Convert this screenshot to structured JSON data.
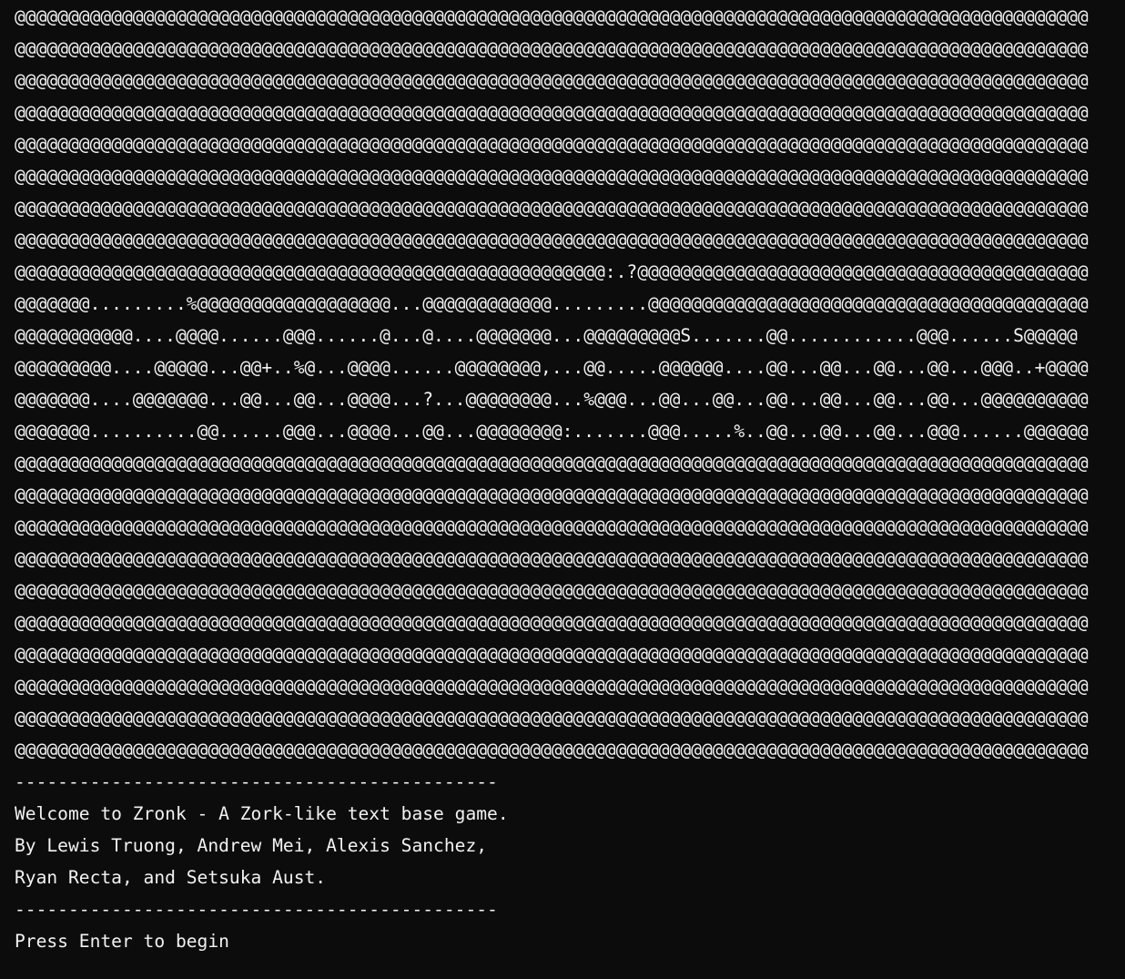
{
  "window": {
    "background": "#0c0c0c",
    "foreground": "#f2f2f2"
  },
  "art": [
    "@@@@@@@@@@@@@@@@@@@@@@@@@@@@@@@@@@@@@@@@@@@@@@@@@@@@@@@@@@@@@@@@@@@@@@@@@@@@@@@@@@@@@@@@@@@@@@@@@@@@",
    "@@@@@@@@@@@@@@@@@@@@@@@@@@@@@@@@@@@@@@@@@@@@@@@@@@@@@@@@@@@@@@@@@@@@@@@@@@@@@@@@@@@@@@@@@@@@@@@@@@@@",
    "@@@@@@@@@@@@@@@@@@@@@@@@@@@@@@@@@@@@@@@@@@@@@@@@@@@@@@@@@@@@@@@@@@@@@@@@@@@@@@@@@@@@@@@@@@@@@@@@@@@@",
    "@@@@@@@@@@@@@@@@@@@@@@@@@@@@@@@@@@@@@@@@@@@@@@@@@@@@@@@@@@@@@@@@@@@@@@@@@@@@@@@@@@@@@@@@@@@@@@@@@@@@",
    "@@@@@@@@@@@@@@@@@@@@@@@@@@@@@@@@@@@@@@@@@@@@@@@@@@@@@@@@@@@@@@@@@@@@@@@@@@@@@@@@@@@@@@@@@@@@@@@@@@@@",
    "@@@@@@@@@@@@@@@@@@@@@@@@@@@@@@@@@@@@@@@@@@@@@@@@@@@@@@@@@@@@@@@@@@@@@@@@@@@@@@@@@@@@@@@@@@@@@@@@@@@@",
    "@@@@@@@@@@@@@@@@@@@@@@@@@@@@@@@@@@@@@@@@@@@@@@@@@@@@@@@@@@@@@@@@@@@@@@@@@@@@@@@@@@@@@@@@@@@@@@@@@@@@",
    "@@@@@@@@@@@@@@@@@@@@@@@@@@@@@@@@@@@@@@@@@@@@@@@@@@@@@@@@@@@@@@@@@@@@@@@@@@@@@@@@@@@@@@@@@@@@@@@@@@@@",
    "@@@@@@@@@@@@@@@@@@@@@@@@@@@@@@@@@@@@@@@@@@@@@@@@@@@@@@@:.?@@@@@@@@@@@@@@@@@@@@@@@@@@@@@@@@@@@@@@@@@@",
    "@@@@@@@.........%@@@@@@@@@@@@@@@@@@...@@@@@@@@@@@@.........@@@@@@@@@@@@@@@@@@@@@@@@@@@@@@@@@@@@@@@@@",
    "@@@@@@@@@@@....@@@@......@@@......@...@....@@@@@@@...@@@@@@@@@S.......@@............@@@......S@@@@@",
    "@@@@@@@@@....@@@@@...@@+..%@...@@@@......@@@@@@@@,...@@.....@@@@@@....@@...@@...@@...@@...@@@..+@@@@",
    "@@@@@@@....@@@@@@@...@@...@@...@@@@...?...@@@@@@@@...%@@@...@@...@@...@@...@@...@@...@@...@@@@@@@@@@",
    "@@@@@@@..........@@......@@@...@@@@...@@...@@@@@@@@:.......@@@.....%..@@...@@...@@...@@@......@@@@@@",
    "@@@@@@@@@@@@@@@@@@@@@@@@@@@@@@@@@@@@@@@@@@@@@@@@@@@@@@@@@@@@@@@@@@@@@@@@@@@@@@@@@@@@@@@@@@@@@@@@@@@@",
    "@@@@@@@@@@@@@@@@@@@@@@@@@@@@@@@@@@@@@@@@@@@@@@@@@@@@@@@@@@@@@@@@@@@@@@@@@@@@@@@@@@@@@@@@@@@@@@@@@@@@",
    "@@@@@@@@@@@@@@@@@@@@@@@@@@@@@@@@@@@@@@@@@@@@@@@@@@@@@@@@@@@@@@@@@@@@@@@@@@@@@@@@@@@@@@@@@@@@@@@@@@@@",
    "@@@@@@@@@@@@@@@@@@@@@@@@@@@@@@@@@@@@@@@@@@@@@@@@@@@@@@@@@@@@@@@@@@@@@@@@@@@@@@@@@@@@@@@@@@@@@@@@@@@@",
    "@@@@@@@@@@@@@@@@@@@@@@@@@@@@@@@@@@@@@@@@@@@@@@@@@@@@@@@@@@@@@@@@@@@@@@@@@@@@@@@@@@@@@@@@@@@@@@@@@@@@",
    "@@@@@@@@@@@@@@@@@@@@@@@@@@@@@@@@@@@@@@@@@@@@@@@@@@@@@@@@@@@@@@@@@@@@@@@@@@@@@@@@@@@@@@@@@@@@@@@@@@@@",
    "@@@@@@@@@@@@@@@@@@@@@@@@@@@@@@@@@@@@@@@@@@@@@@@@@@@@@@@@@@@@@@@@@@@@@@@@@@@@@@@@@@@@@@@@@@@@@@@@@@@@",
    "@@@@@@@@@@@@@@@@@@@@@@@@@@@@@@@@@@@@@@@@@@@@@@@@@@@@@@@@@@@@@@@@@@@@@@@@@@@@@@@@@@@@@@@@@@@@@@@@@@@@",
    "@@@@@@@@@@@@@@@@@@@@@@@@@@@@@@@@@@@@@@@@@@@@@@@@@@@@@@@@@@@@@@@@@@@@@@@@@@@@@@@@@@@@@@@@@@@@@@@@@@@@",
    "@@@@@@@@@@@@@@@@@@@@@@@@@@@@@@@@@@@@@@@@@@@@@@@@@@@@@@@@@@@@@@@@@@@@@@@@@@@@@@@@@@@@@@@@@@@@@@@@@@@@"
  ],
  "divider": "---------------------------------------------",
  "welcome_line": "Welcome to Zronk - A Zork-like text base game.",
  "credits_line_1": "By Lewis Truong, Andrew Mei, Alexis Sanchez,",
  "credits_line_2": "Ryan Recta, and Setsuka Aust.",
  "prompt": "Press Enter to begin"
}
